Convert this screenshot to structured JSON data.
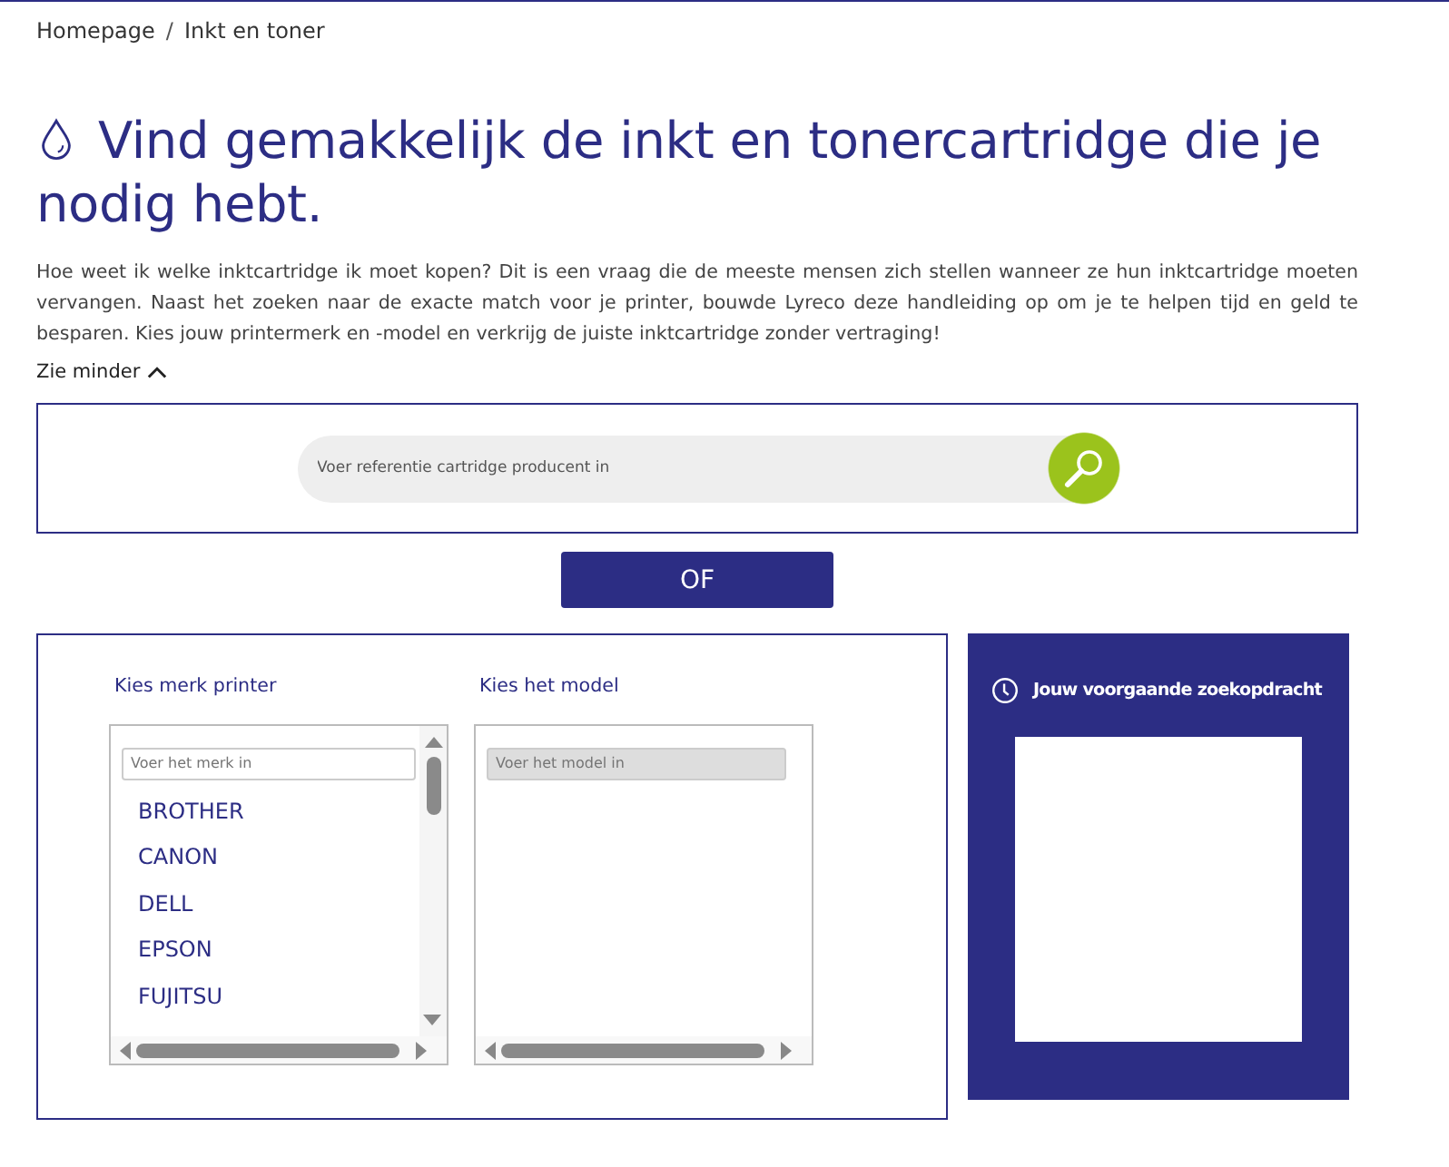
{
  "breadcrumb": [
    {
      "label": "Homepage"
    },
    {
      "label": "Inkt en toner"
    }
  ],
  "breadcrumb_separator": "/",
  "title": "Vind gemakkelijk de inkt en tonercartridge die je nodig hebt.",
  "intro": "Hoe weet ik welke inktcartridge ik moet kopen? Dit is een vraag die de meeste mensen zich stellen wanneer ze hun inktcartridge moeten vervangen. Naast het zoeken naar de exacte match voor je printer, bouwde Lyreco deze handleiding op om je te helpen tijd en geld te besparen. Kies jouw printermerk en -model en verkrijg de juiste inktcartridge zonder vertraging!",
  "toggle": {
    "label": "Zie minder",
    "expanded": true
  },
  "search": {
    "placeholder": "Voer referentie cartridge producent in"
  },
  "or_button": "OF",
  "brand": {
    "label": "Kies merk printer",
    "placeholder": "Voer het merk in",
    "disabled": false,
    "items": [
      "BROTHER",
      "CANON",
      "DELL",
      "EPSON",
      "FUJITSU"
    ]
  },
  "model": {
    "label": "Kies het model",
    "placeholder": "Voer het model in",
    "disabled": true
  },
  "recent": {
    "title": "Jouw voorgaande zoekopdracht"
  }
}
